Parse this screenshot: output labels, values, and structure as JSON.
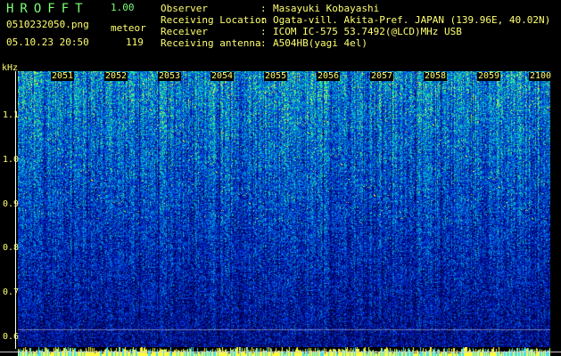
{
  "header": {
    "app_title": "HROFFT",
    "version": "1.00",
    "filename": "0510232050.png",
    "mode": "meteor",
    "datetime": "05.10.23 20:50",
    "count": "119"
  },
  "info": [
    {
      "label": "Observer",
      "sep": ":",
      "value": "Masayuki Kobayashi"
    },
    {
      "label": "Receiving Location",
      "sep": ":",
      "value": "Ogata-vill. Akita-Pref. JAPAN (139.96E, 40.02N)"
    },
    {
      "label": "Receiver",
      "sep": ":",
      "value": "ICOM IC-575 53.7492(@LCD)MHz USB"
    },
    {
      "label": "Receiving antenna",
      "sep": ":",
      "value": "A504HB(yagi 4el)"
    }
  ],
  "axes": {
    "y_unit": "kHz",
    "y_ticks": [
      "1.1",
      "1.0",
      "0.9",
      "0.8",
      "0.7",
      "0.6"
    ],
    "x_ticks": [
      "2051",
      "2052",
      "2053",
      "2054",
      "2055",
      "2056",
      "2057",
      "2058",
      "2059",
      "2100"
    ]
  },
  "colors": {
    "title_green": "#7cff74",
    "label_yellow": "#ffff70",
    "background": "#000000"
  }
}
